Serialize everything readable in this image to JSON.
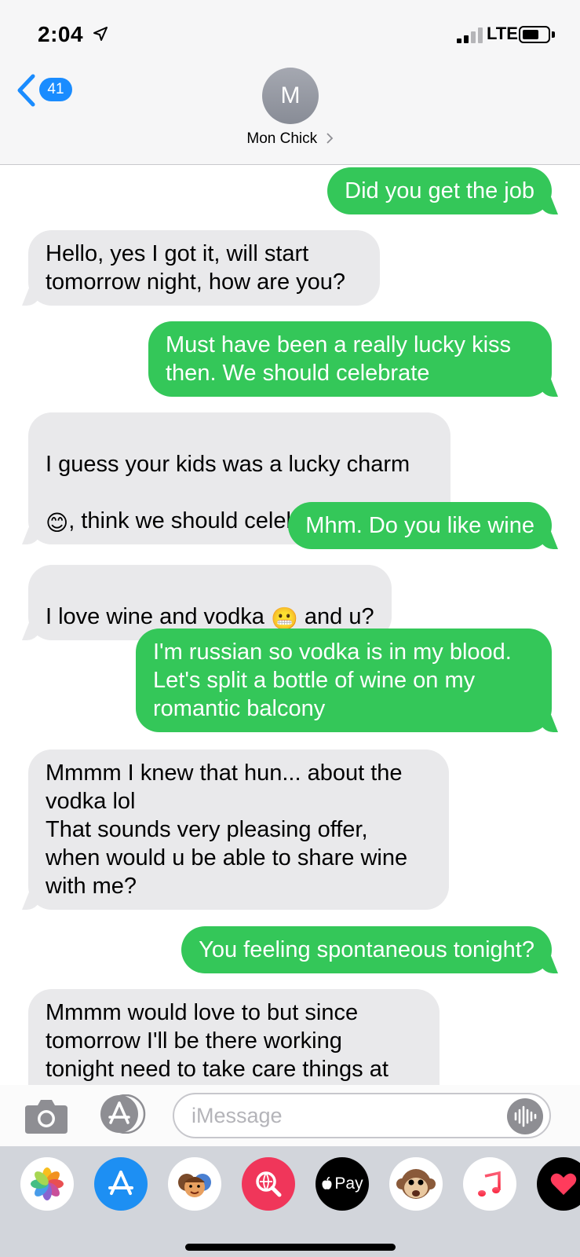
{
  "status_bar": {
    "time": "2:04",
    "network": "LTE"
  },
  "header": {
    "back_count": "41",
    "avatar_initial": "M",
    "contact_name": "Mon Chick"
  },
  "messages": [
    {
      "dir": "out",
      "text": "Did you get the job"
    },
    {
      "dir": "in",
      "text": "Hello, yes I got it, will start\ntomorrow night, how are you?"
    },
    {
      "dir": "out",
      "text": "Must have been a really lucky kiss\nthen. We should celebrate"
    },
    {
      "dir": "in",
      "line1": "I guess your kids was a lucky charm",
      "emoji1": "😊",
      "line2": ", think we should celebrate ",
      "emoji2": "🎉"
    },
    {
      "dir": "out",
      "text": "Mhm. Do you like wine"
    },
    {
      "dir": "in",
      "part1": "I love wine and vodka ",
      "emoji": "😬",
      "part2": " and u?"
    },
    {
      "dir": "out",
      "text": "I'm russian so vodka is in my blood.\nLet's split a bottle of wine on my\nromantic balcony"
    },
    {
      "dir": "in",
      "text": "Mmmm I knew that hun... about the\nvodka lol\nThat sounds very pleasing offer,\nwhen would u be able to share wine\nwith me?"
    },
    {
      "dir": "out",
      "text": "You feeling spontaneous tonight?"
    },
    {
      "dir": "in",
      "text": "Mmmm would love to but since\ntomorrow I'll be there working\ntonight need to take care things at"
    }
  ],
  "compose": {
    "placeholder": "iMessage"
  },
  "drawer": {
    "apps": [
      {
        "icon": "photos-icon"
      },
      {
        "icon": "app-store-icon"
      },
      {
        "icon": "memoji-icon"
      },
      {
        "icon": "web-search-icon"
      },
      {
        "icon": "apple-pay-icon",
        "label": "Pay"
      },
      {
        "icon": "animoji-icon"
      },
      {
        "icon": "music-icon"
      },
      {
        "icon": "digital-touch-icon"
      }
    ]
  },
  "colors": {
    "outgoing": "#34c759",
    "incoming": "#e9e9eb",
    "accent": "#1a8cff"
  }
}
